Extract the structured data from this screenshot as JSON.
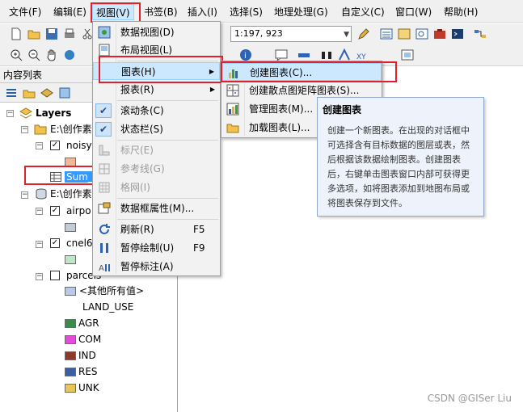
{
  "menubar": {
    "items": [
      "文件(F)",
      "编辑(E)",
      "视图(V)",
      "书签(B)",
      "插入(I)",
      "选择(S)",
      "地理处理(G)",
      "自定义(C)",
      "窗口(W)",
      "帮助(H)"
    ]
  },
  "toolbar": {
    "scale": "1:197, 923"
  },
  "toc": {
    "title": "内容列表",
    "root": "Layers",
    "group1": "E:\\创作素",
    "layer_noisy": "noisy",
    "table_sum": "Sum_",
    "group2": "E:\\创作素",
    "layer_airport": "airpo",
    "layer_cnel": "cnel6",
    "layer_parcels": "parcels",
    "other_values": "<其他所有值>",
    "field_land_use": "LAND_USE",
    "categories": [
      {
        "label": "AGR",
        "color": "#3c8a4e"
      },
      {
        "label": "COM",
        "color": "#e64bd8"
      },
      {
        "label": "IND",
        "color": "#8b3a2c"
      },
      {
        "label": "RES",
        "color": "#3b5fa0"
      },
      {
        "label": "UNK",
        "color": "#e8c45a"
      }
    ]
  },
  "view_menu": {
    "items": [
      {
        "label": "数据视图(D)"
      },
      {
        "label": "布局视图(L)"
      },
      {
        "label": "图表(H)"
      },
      {
        "label": "报表(R)"
      },
      {
        "label": "滚动条(C)"
      },
      {
        "label": "状态栏(S)"
      },
      {
        "label": "标尺(E)"
      },
      {
        "label": "参考线(G)"
      },
      {
        "label": "格网(I)"
      },
      {
        "label": "数据框属性(M)..."
      },
      {
        "label": "刷新(R)",
        "shortcut": "F5"
      },
      {
        "label": "暂停绘制(U)",
        "shortcut": "F9"
      },
      {
        "label": "暂停标注(A)"
      }
    ]
  },
  "chart_submenu": {
    "items": [
      {
        "label": "创建图表(C)..."
      },
      {
        "label": "创建散点图矩阵图表(S)..."
      },
      {
        "label": "管理图表(M)..."
      },
      {
        "label": "加载图表(L)..."
      }
    ]
  },
  "tooltip": {
    "title": "创建图表",
    "body": "创建一个新图表。在出现的对话框中可选择含有目标数据的图层或表，然后根据该数据绘制图表。创建图表后，右键单击图表窗口内部可获得更多选项，如将图表添加到地图布局或将图表保存到文件。"
  },
  "watermark": "CSDN @GISer Liu",
  "colors": {
    "highlight": "#cce8ff",
    "annotation_red": "#e0202a",
    "selection": "#3399ff"
  }
}
